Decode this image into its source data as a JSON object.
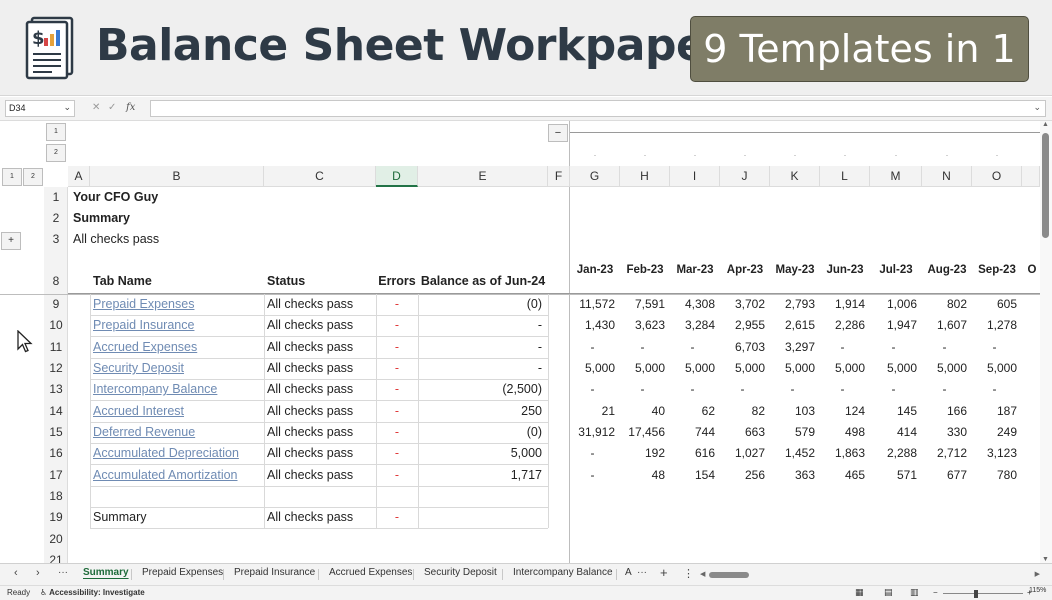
{
  "banner": {
    "title": "Balance Sheet Workpapers",
    "badge": "9 Templates in 1",
    "icon": "financial-document-icon",
    "badge_color": "#7f7d67"
  },
  "formula_bar": {
    "cell_ref": "D34",
    "fx_label": "fx",
    "formula": ""
  },
  "outline": {
    "level_buttons_top": [
      "1",
      "2"
    ],
    "level_buttons_left": [
      "1",
      "2"
    ],
    "collapse_symbol": "−",
    "expand_symbol": "+"
  },
  "columns": [
    "A",
    "B",
    "C",
    "D",
    "E",
    "F",
    "G",
    "H",
    "I",
    "J",
    "K",
    "L",
    "M",
    "N",
    "O"
  ],
  "selected_column": "D",
  "rows": {
    "numbers": [
      "1",
      "2",
      "3",
      "8",
      "9",
      "10",
      "11",
      "12",
      "13",
      "14",
      "15",
      "16",
      "17",
      "18",
      "19",
      "20",
      "21"
    ],
    "company": "Your CFO Guy",
    "summary_title": "Summary",
    "overall_status": "All checks pass"
  },
  "table": {
    "headers": {
      "tab_name": "Tab Name",
      "status": "Status",
      "errors": "Errors",
      "balance": "Balance as of Jun-24"
    },
    "months": [
      "Jan-23",
      "Feb-23",
      "Mar-23",
      "Apr-23",
      "May-23",
      "Jun-23",
      "Jul-23",
      "Aug-23",
      "Sep-23",
      "O"
    ],
    "rows": [
      {
        "name": "Prepaid Expenses",
        "status": "All checks pass",
        "errors": "-",
        "balance": "(0)",
        "months": [
          "11,572",
          "7,591",
          "4,308",
          "3,702",
          "2,793",
          "1,914",
          "1,006",
          "802",
          "605",
          ""
        ]
      },
      {
        "name": "Prepaid Insurance",
        "status": "All checks pass",
        "errors": "-",
        "balance": "-",
        "months": [
          "1,430",
          "3,623",
          "3,284",
          "2,955",
          "2,615",
          "2,286",
          "1,947",
          "1,607",
          "1,278",
          ""
        ]
      },
      {
        "name": "Accrued Expenses",
        "status": "All checks pass",
        "errors": "-",
        "balance": "-",
        "months": [
          "-",
          "-",
          "-",
          "6,703",
          "3,297",
          "-",
          "-",
          "-",
          "-",
          ""
        ]
      },
      {
        "name": "Security Deposit",
        "status": "All checks pass",
        "errors": "-",
        "balance": "-",
        "months": [
          "5,000",
          "5,000",
          "5,000",
          "5,000",
          "5,000",
          "5,000",
          "5,000",
          "5,000",
          "5,000",
          ""
        ]
      },
      {
        "name": "Intercompany Balance",
        "status": "All checks pass",
        "errors": "-",
        "balance": "(2,500)",
        "months": [
          "-",
          "-",
          "-",
          "-",
          "-",
          "-",
          "-",
          "-",
          "-",
          ""
        ]
      },
      {
        "name": "Accrued Interest",
        "status": "All checks pass",
        "errors": "-",
        "balance": "250",
        "months": [
          "21",
          "40",
          "62",
          "82",
          "103",
          "124",
          "145",
          "166",
          "187",
          ""
        ]
      },
      {
        "name": "Deferred Revenue",
        "status": "All checks pass",
        "errors": "-",
        "balance": "(0)",
        "months": [
          "31,912",
          "17,456",
          "744",
          "663",
          "579",
          "498",
          "414",
          "330",
          "249",
          ""
        ]
      },
      {
        "name": "Accumulated Depreciation",
        "status": "All checks pass",
        "errors": "-",
        "balance": "5,000",
        "months": [
          "-",
          "192",
          "616",
          "1,027",
          "1,452",
          "1,863",
          "2,288",
          "2,712",
          "3,123",
          ":"
        ]
      },
      {
        "name": "Accumulated Amortization",
        "status": "All checks pass",
        "errors": "-",
        "balance": "1,717",
        "months": [
          "-",
          "48",
          "154",
          "256",
          "363",
          "465",
          "571",
          "677",
          "780",
          ""
        ]
      }
    ],
    "summary_row": {
      "name": "Summary",
      "status": "All checks pass",
      "errors": "-"
    }
  },
  "sheet_tabs": {
    "tabs": [
      "Summary",
      "Prepaid Expenses",
      "Prepaid Insurance",
      "Accrued Expenses",
      "Security Deposit",
      "Intercompany Balance",
      "A"
    ],
    "active": "Summary",
    "more": "···",
    "add": "+",
    "options": "⋮"
  },
  "status_bar": {
    "ready": "Ready",
    "accessibility": "Accessibility: Investigate",
    "zoom": "115%"
  },
  "colors": {
    "link": "#6f8bb3",
    "error_dash": "#e03a3a",
    "excel_green": "#217346"
  }
}
